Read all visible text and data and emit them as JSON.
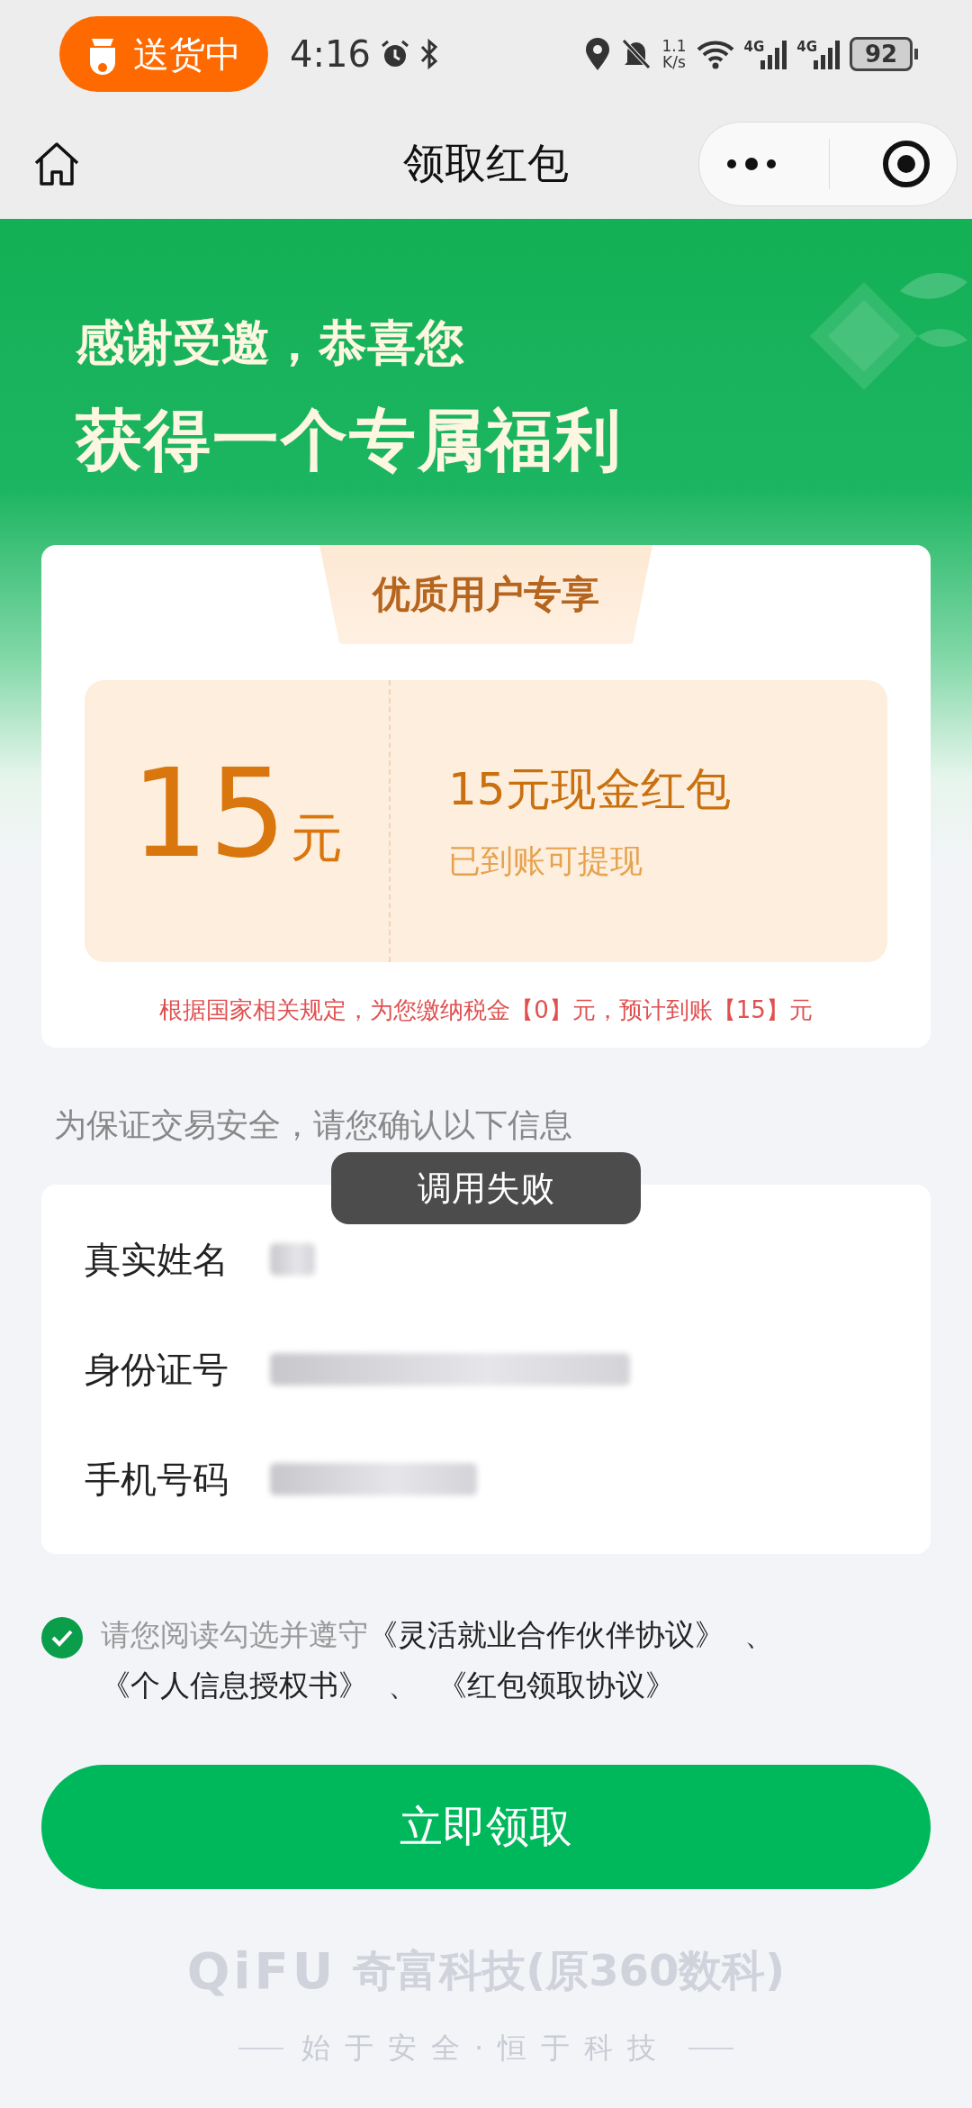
{
  "status_bar": {
    "activity": "送货中",
    "time": "4:16",
    "net_speed": "1.1",
    "net_speed_unit": "K/s",
    "sim_labels": [
      "4G",
      "4G"
    ],
    "battery": "92"
  },
  "nav": {
    "title": "领取红包"
  },
  "hero": {
    "line1": "感谢受邀，恭喜您",
    "line2": "获得一个专属福利"
  },
  "coupon_card": {
    "ribbon": "优质用户专享",
    "amount": "15",
    "unit": "元",
    "title": "15元现金红包",
    "subtitle": "已到账可提现",
    "tax_note": "根据国家相关规定，为您缴纳税金【0】元，预计到账【15】元"
  },
  "info_section": {
    "label": "为保证交易安全，请您确认以下信息",
    "fields": [
      {
        "label": "真实姓名"
      },
      {
        "label": "身份证号"
      },
      {
        "label": "手机号码"
      }
    ]
  },
  "toast": "调用失败",
  "agreement": {
    "checked": true,
    "text": "请您阅读勾选并遵守",
    "links": [
      {
        "text": "《灵活就业合作伙伴协议》"
      },
      {
        "separator": "、",
        "text": "《个人信息授权书》"
      },
      {
        "separator": "、",
        "text": "《红包领取协议》"
      }
    ]
  },
  "claim_button": "立即领取",
  "footer": {
    "brand": "QiFU",
    "company": "奇富科技(原360数科)",
    "slogan": "始于安全·恒于科技"
  }
}
